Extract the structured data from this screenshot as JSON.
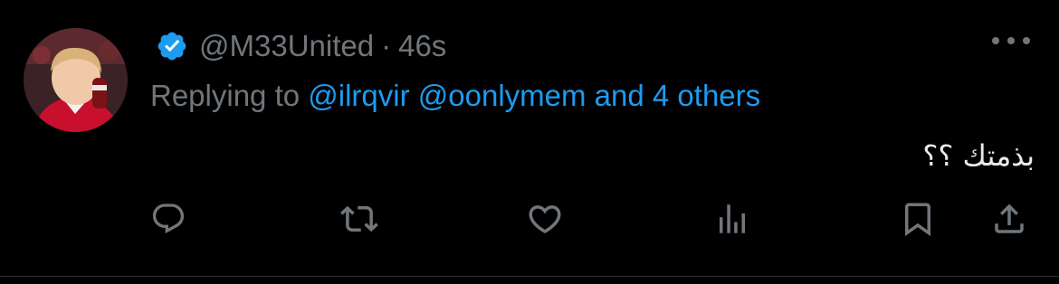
{
  "tweet": {
    "handle": "@M33United",
    "separator": "·",
    "time": "46s",
    "replying_prefix": "Replying to ",
    "reply_mentions": [
      "@ilrqvir",
      "@oonlymem"
    ],
    "reply_others": "and 4 others",
    "text": "بذمتك ؟؟"
  },
  "colors": {
    "background": "#000000",
    "secondary_text": "#71767b",
    "link": "#1d9bf0",
    "verified_badge": "#1d9bf0",
    "primary_text": "#e7e9ea"
  },
  "icons": {
    "verified": "verified-badge-icon",
    "more": "more-horizontal-icon",
    "reply": "reply-bubble-icon",
    "retweet": "retweet-icon",
    "like": "heart-icon",
    "views": "views-bars-icon",
    "bookmark": "bookmark-icon",
    "share": "share-icon"
  }
}
